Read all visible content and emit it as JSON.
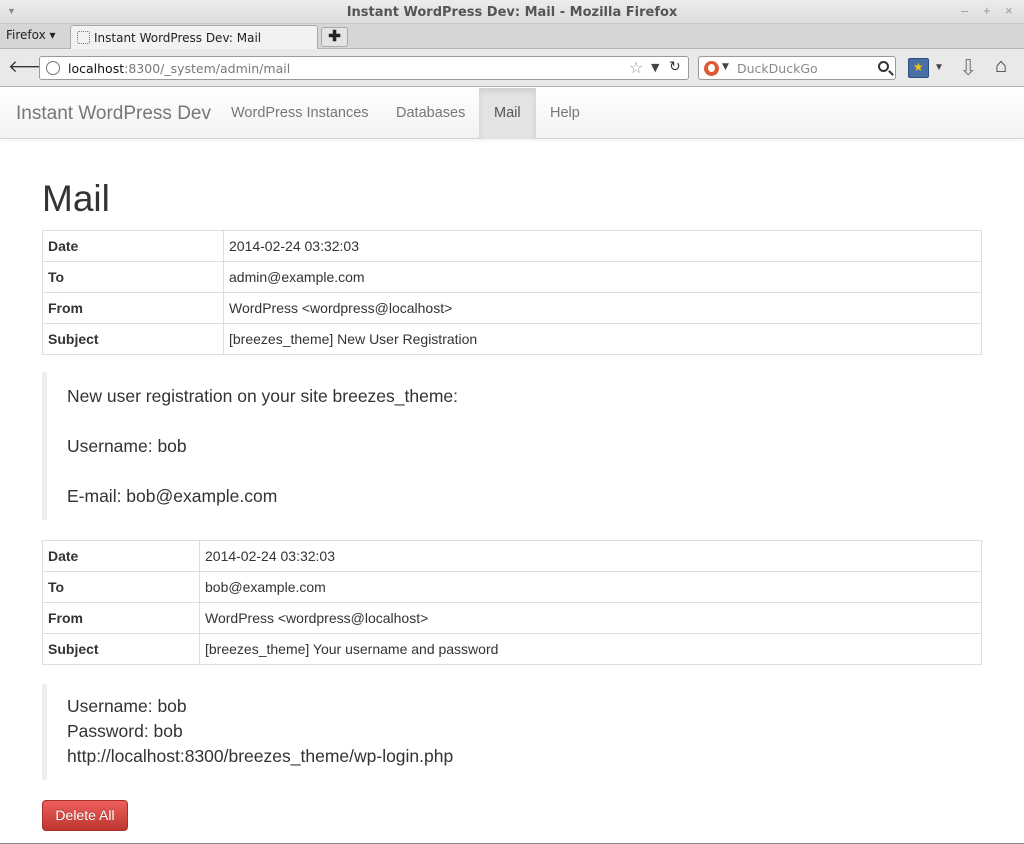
{
  "window": {
    "title": "Instant WordPress Dev: Mail - Mozilla Firefox",
    "minimize_glyph": "–",
    "maximize_glyph": "+",
    "close_glyph": "×"
  },
  "browser": {
    "menu_label": "Firefox ▾",
    "tab_title": "Instant WordPress Dev: Mail",
    "url_host": "localhost",
    "url_rest": ":8300/_system/admin/mail",
    "search_placeholder": "DuckDuckGo"
  },
  "site": {
    "brand": "Instant WordPress Dev",
    "nav": [
      {
        "label": "WordPress Instances",
        "active": false
      },
      {
        "label": "Databases",
        "active": false
      },
      {
        "label": "Mail",
        "active": true
      },
      {
        "label": "Help",
        "active": false
      }
    ]
  },
  "page": {
    "heading": "Mail",
    "delete_all_label": "Delete All"
  },
  "mails": [
    {
      "fields": [
        {
          "key": "Date",
          "value": "2014-02-24 03:32:03"
        },
        {
          "key": "To",
          "value": "admin@example.com"
        },
        {
          "key": "From",
          "value": "WordPress <wordpress@localhost>"
        },
        {
          "key": "Subject",
          "value": "[breezes_theme] New User Registration"
        }
      ],
      "body": [
        "New user registration on your site breezes_theme:",
        "",
        "Username: bob",
        "",
        "E-mail: bob@example.com"
      ]
    },
    {
      "fields": [
        {
          "key": "Date",
          "value": "2014-02-24 03:32:03"
        },
        {
          "key": "To",
          "value": "bob@example.com"
        },
        {
          "key": "From",
          "value": "WordPress <wordpress@localhost>"
        },
        {
          "key": "Subject",
          "value": "[breezes_theme] Your username and password"
        }
      ],
      "body": [
        "Username: bob",
        "Password: bob",
        "http://localhost:8300/breezes_theme/wp-login.php"
      ]
    }
  ],
  "colors": {
    "danger_button": "#da4f49",
    "active_nav_bg": "#e4e4e4"
  }
}
